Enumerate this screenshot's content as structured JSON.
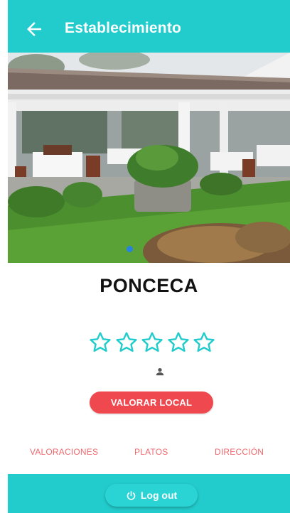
{
  "appbar": {
    "title": "Establecimiento",
    "back_icon": "arrow-left-icon"
  },
  "establishment": {
    "name": "PONCECA",
    "image_pages": 1,
    "current_image": 1,
    "rating": 0,
    "rating_max": 5,
    "rate_button_label": "VALORAR LOCAL"
  },
  "tabs": [
    {
      "label": "VALORACIONES"
    },
    {
      "label": "PLATOS"
    },
    {
      "label": "DIRECCIÓN"
    }
  ],
  "footer": {
    "logout_label": "Log out",
    "logout_icon": "power-icon"
  },
  "colors": {
    "primary": "#23cccc",
    "accent_red": "#f0484f",
    "tab_text": "#ef6a6f",
    "star_outline": "#23cccc"
  }
}
